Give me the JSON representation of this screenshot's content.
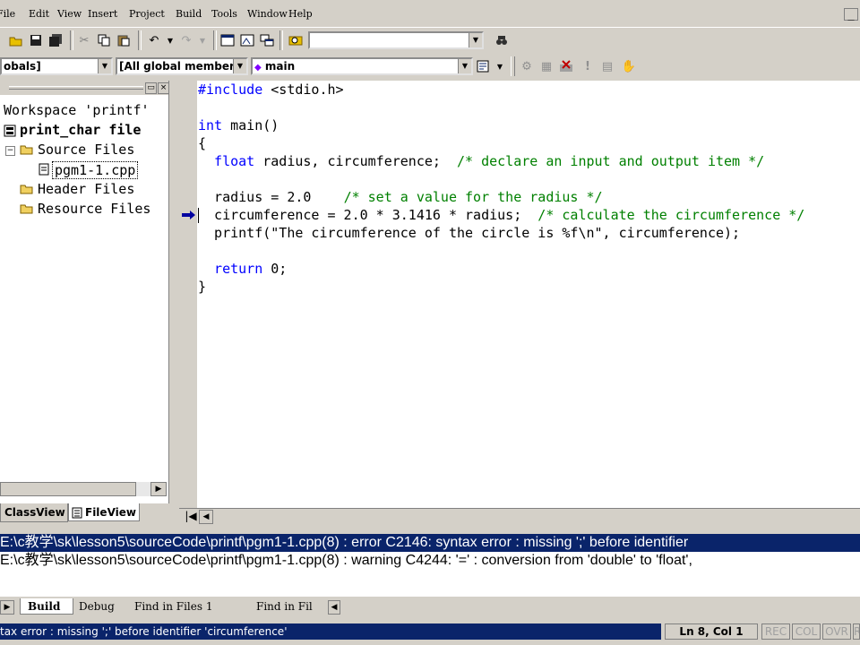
{
  "menubar": {
    "items": [
      "File",
      "Edit",
      "View",
      "Insert",
      "Project",
      "Build",
      "Tools",
      "Window",
      "Help"
    ],
    "minimize": "_"
  },
  "toolbar": {
    "icons": [
      "open-folder-icon",
      "save-icon",
      "save-all-icon",
      "cut-icon",
      "copy-icon",
      "paste-icon",
      "undo-icon",
      "redo-icon",
      "workspace-icon",
      "output-icon",
      "window-list-icon",
      "find-in-files-icon",
      "find-icon"
    ],
    "find_value": ""
  },
  "wizardbar": {
    "class_combo": "obals]",
    "filter_combo": "[All global members",
    "member_combo": "main"
  },
  "workspace": {
    "title": "Workspace 'printf'",
    "project": "print_char file",
    "source_files": "Source Files",
    "file": "pgm1-1.cpp",
    "header_files": "Header Files",
    "resource_files": "Resource Files",
    "tabs": [
      "ClassView",
      "FileView"
    ]
  },
  "editor": {
    "lines": [
      {
        "kw": "#include",
        "text": " <stdio.h>",
        "comment": ""
      },
      {
        "kw": "",
        "text": "",
        "comment": ""
      },
      {
        "kw": "int",
        "text": " main()",
        "comment": ""
      },
      {
        "kw": "",
        "text": "{",
        "comment": ""
      },
      {
        "kw": "  float",
        "text": " radius, circumference;  ",
        "comment": "/* declare an input and output item */"
      },
      {
        "kw": "",
        "text": "",
        "comment": ""
      },
      {
        "kw": "",
        "text": "  radius = 2.0    ",
        "comment": "/* set a value for the radius */"
      },
      {
        "kw": "",
        "text": "  circumference = 2.0 * 3.1416 * radius;  ",
        "comment": "/* calculate the circumference */"
      },
      {
        "kw": "",
        "text": "  printf(\"The circumference of the circle is %f\\n\", circumference);",
        "comment": ""
      },
      {
        "kw": "",
        "text": "",
        "comment": ""
      },
      {
        "kw": "  return",
        "text": " 0;",
        "comment": ""
      },
      {
        "kw": "",
        "text": "}",
        "comment": ""
      }
    ]
  },
  "output": {
    "line1": "E:\\c教学\\sk\\lesson5\\sourceCode\\printf\\pgm1-1.cpp(8) : error C2146: syntax error : missing ';' before identifier",
    "line2": "E:\\c教学\\sk\\lesson5\\sourceCode\\printf\\pgm1-1.cpp(8) : warning C4244: '=' : conversion from 'double' to 'float',",
    "tabs": [
      "Build",
      "Debug",
      "Find in Files 1",
      "Find in Fil"
    ]
  },
  "statusbar": {
    "message": "tax error : missing ';' before identifier 'circumference'",
    "position": "Ln 8, Col 1",
    "rec": "REC",
    "col": "COL",
    "ovr": "OVR",
    "read": "R"
  },
  "colors": {
    "chrome": "#d4d0c8",
    "selection": "#0a246a",
    "keyword": "#0000ff",
    "comment": "#008000"
  }
}
